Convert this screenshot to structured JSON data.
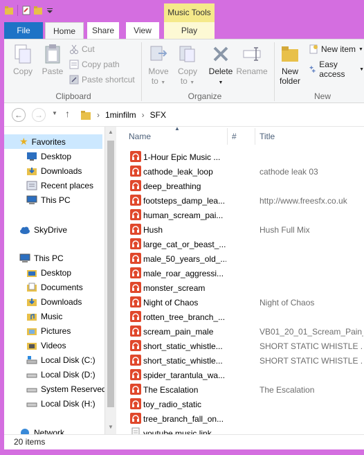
{
  "colors": {
    "window_frame": "#d46ee0",
    "file_tab": "#1e73c6",
    "context_tab": "#f5e98a",
    "selected_nav": "#cce8ff",
    "audio_icon": "#e0482c"
  },
  "ribbon": {
    "contextual_header": "Music Tools",
    "tabs": {
      "file": "File",
      "home": "Home",
      "share": "Share",
      "view": "View",
      "play": "Play"
    },
    "clipboard": {
      "copy": "Copy",
      "paste": "Paste",
      "cut": "Cut",
      "copy_path": "Copy path",
      "paste_shortcut": "Paste shortcut",
      "label": "Clipboard"
    },
    "organize": {
      "move_to_1": "Move",
      "move_to_2": "to",
      "copy_to_1": "Copy",
      "copy_to_2": "to",
      "delete": "Delete",
      "rename": "Rename",
      "label": "Organize"
    },
    "new": {
      "new_folder_1": "New",
      "new_folder_2": "folder",
      "new_item": "New item",
      "easy_access": "Easy access",
      "label": "New"
    }
  },
  "address": {
    "back_icon": "back-arrow-icon",
    "forward_icon": "forward-arrow-icon",
    "crumbs": [
      "1minfilm",
      "SFX"
    ]
  },
  "nav": {
    "favorites_header": "Favorites",
    "favorites": [
      "Desktop",
      "Downloads",
      "Recent places",
      "This PC"
    ],
    "skydrive": "SkyDrive",
    "thispc_header": "This PC",
    "thispc": [
      "Desktop",
      "Documents",
      "Downloads",
      "Music",
      "Pictures",
      "Videos",
      "Local Disk (C:)",
      "Local Disk (D:)",
      "System Reserved",
      "Local Disk (H:)"
    ],
    "network": "Network"
  },
  "columns": {
    "name": "Name",
    "number": "#",
    "title": "Title"
  },
  "files": [
    {
      "name": "1-Hour Epic Music ...",
      "title": ""
    },
    {
      "name": "cathode_leak_loop",
      "title": "cathode leak 03"
    },
    {
      "name": "deep_breathing",
      "title": ""
    },
    {
      "name": "footsteps_damp_lea...",
      "title": "http://www.freesfx.co.uk"
    },
    {
      "name": "human_scream_pai...",
      "title": ""
    },
    {
      "name": "Hush",
      "title": "Hush Full Mix"
    },
    {
      "name": "large_cat_or_beast_...",
      "title": ""
    },
    {
      "name": "male_50_years_old_...",
      "title": ""
    },
    {
      "name": "male_roar_aggressi...",
      "title": ""
    },
    {
      "name": "monster_scream",
      "title": ""
    },
    {
      "name": "Night of Chaos",
      "title": "Night of Chaos"
    },
    {
      "name": "rotten_tree_branch_...",
      "title": ""
    },
    {
      "name": "scream_pain_male",
      "title": "VB01_20_01_Scream_Pain_..."
    },
    {
      "name": "short_static_whistle...",
      "title": "SHORT STATIC WHISTLE ..."
    },
    {
      "name": "short_static_whistle...",
      "title": "SHORT STATIC WHISTLE ..."
    },
    {
      "name": "spider_tarantula_wa...",
      "title": ""
    },
    {
      "name": "The Escalation",
      "title": "The Escalation"
    },
    {
      "name": "toy_radio_static",
      "title": ""
    },
    {
      "name": "tree_branch_fall_on...",
      "title": ""
    },
    {
      "name": "youtube music link",
      "title": ""
    }
  ],
  "status": {
    "count": "20 items"
  }
}
